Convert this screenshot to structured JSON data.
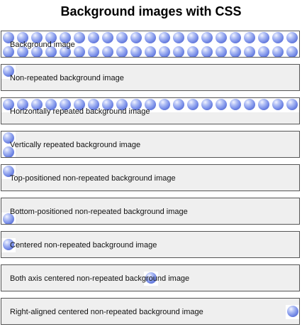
{
  "page": {
    "title": "Background images with CSS"
  },
  "boxes": [
    {
      "label": "Background image"
    },
    {
      "label": "Non-repeated background image"
    },
    {
      "label": "Horizontally repeated background image"
    },
    {
      "label": "Vertically repeated background image"
    },
    {
      "label": "Top-positioned non-repeated background image"
    },
    {
      "label": "Bottom-positioned non-repeated background image"
    },
    {
      "label": "Centered non-repeated background image"
    },
    {
      "label": "Both axis centered non-repeated background image"
    },
    {
      "label": "Right-aligned centered non-repeated background image"
    }
  ],
  "icons": {
    "ball": "blue-sphere-icon"
  },
  "colors": {
    "box_background": "#efefef",
    "box_border": "#555555",
    "sphere": "#7f94ea"
  }
}
